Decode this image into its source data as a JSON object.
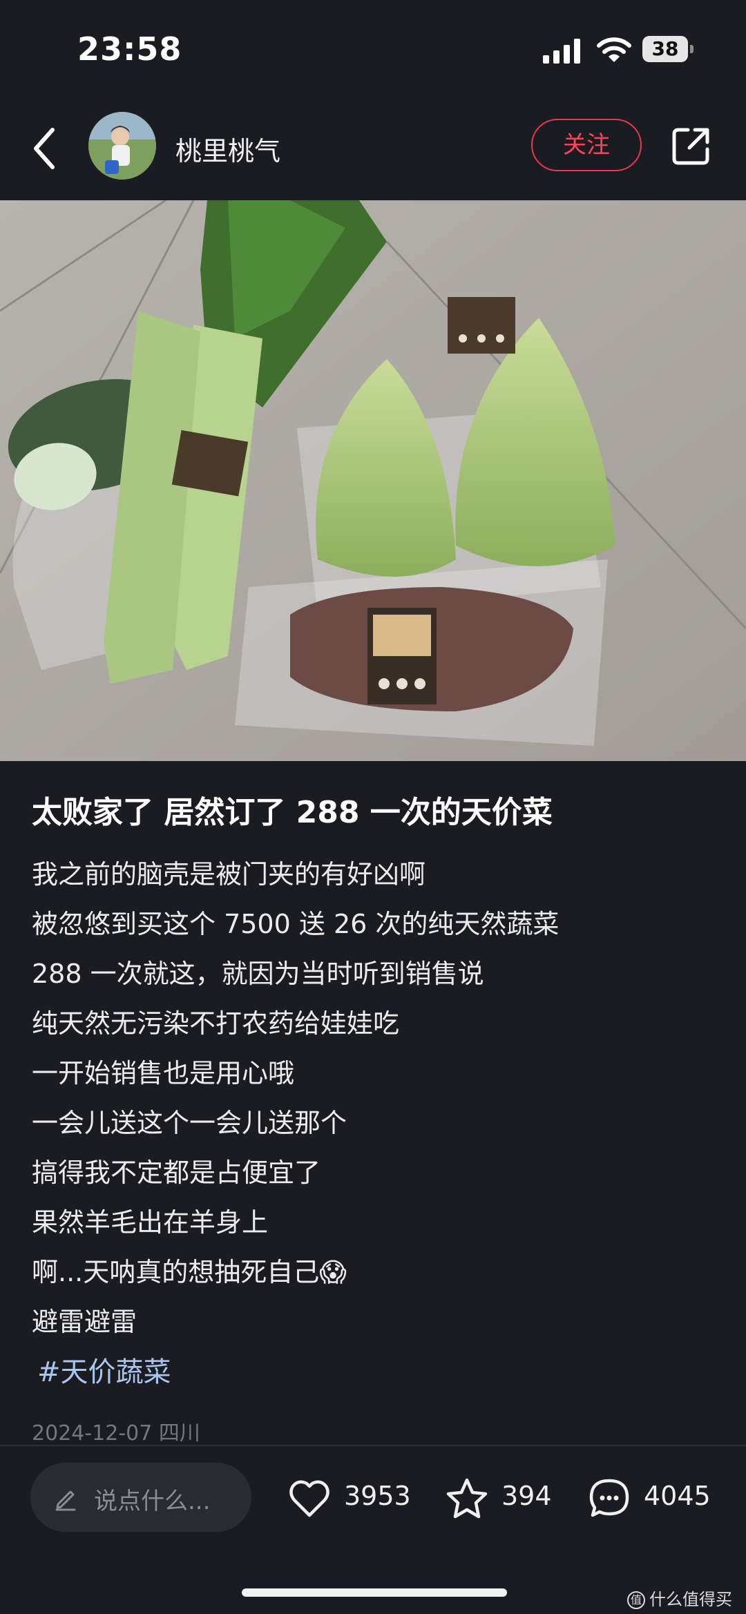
{
  "status_bar": {
    "time": "23:58",
    "battery": "38"
  },
  "header": {
    "username": "桃里桃气",
    "follow_label": "关注"
  },
  "post": {
    "title": "太败家了 居然订了 288 一次的天价菜",
    "lines": [
      "我之前的脑壳是被门夹的有好凶啊",
      "被忽悠到买这个 7500 送 26 次的纯天然蔬菜",
      "288 一次就这，就因为当时听到销售说",
      "纯天然无污染不打农药给娃娃吃",
      "一开始销售也是用心哦",
      "一会儿送这个一会儿送那个",
      "搞得我不定都是占便宜了",
      "果然羊毛出在羊身上",
      "啊...天呐真的想抽死自己😱",
      "避雷避雷"
    ],
    "hashtag": "#天价蔬菜",
    "date_location": "2024-12-07 四川"
  },
  "bottom_bar": {
    "comment_placeholder": "说点什么...",
    "likes": "3953",
    "favorites": "394",
    "comments": "4045"
  },
  "watermark": {
    "icon_text": "值",
    "text": "什么值得买"
  },
  "icons": [
    "back-arrow-icon",
    "share-icon",
    "signal-icon",
    "wifi-icon",
    "battery-icon",
    "pen-icon",
    "heart-icon",
    "star-icon",
    "comment-bubble-icon"
  ],
  "colors": {
    "background": "#1b1b22",
    "follow_accent": "#ff4257",
    "hashtag": "#a9c6ef"
  }
}
